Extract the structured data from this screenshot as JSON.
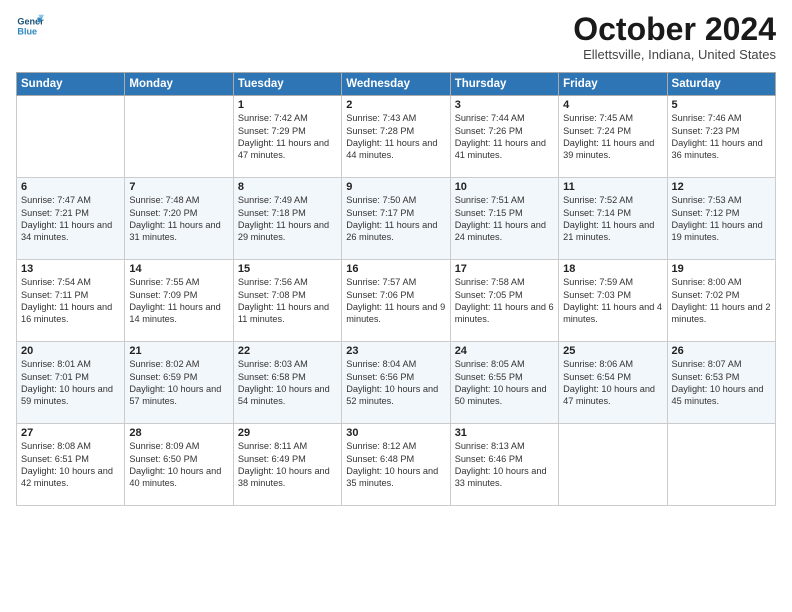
{
  "logo": {
    "line1": "General",
    "line2": "Blue"
  },
  "title": "October 2024",
  "location": "Ellettsville, Indiana, United States",
  "headers": [
    "Sunday",
    "Monday",
    "Tuesday",
    "Wednesday",
    "Thursday",
    "Friday",
    "Saturday"
  ],
  "weeks": [
    [
      {
        "day": "",
        "sunrise": "",
        "sunset": "",
        "daylight": ""
      },
      {
        "day": "",
        "sunrise": "",
        "sunset": "",
        "daylight": ""
      },
      {
        "day": "1",
        "sunrise": "Sunrise: 7:42 AM",
        "sunset": "Sunset: 7:29 PM",
        "daylight": "Daylight: 11 hours and 47 minutes."
      },
      {
        "day": "2",
        "sunrise": "Sunrise: 7:43 AM",
        "sunset": "Sunset: 7:28 PM",
        "daylight": "Daylight: 11 hours and 44 minutes."
      },
      {
        "day": "3",
        "sunrise": "Sunrise: 7:44 AM",
        "sunset": "Sunset: 7:26 PM",
        "daylight": "Daylight: 11 hours and 41 minutes."
      },
      {
        "day": "4",
        "sunrise": "Sunrise: 7:45 AM",
        "sunset": "Sunset: 7:24 PM",
        "daylight": "Daylight: 11 hours and 39 minutes."
      },
      {
        "day": "5",
        "sunrise": "Sunrise: 7:46 AM",
        "sunset": "Sunset: 7:23 PM",
        "daylight": "Daylight: 11 hours and 36 minutes."
      }
    ],
    [
      {
        "day": "6",
        "sunrise": "Sunrise: 7:47 AM",
        "sunset": "Sunset: 7:21 PM",
        "daylight": "Daylight: 11 hours and 34 minutes."
      },
      {
        "day": "7",
        "sunrise": "Sunrise: 7:48 AM",
        "sunset": "Sunset: 7:20 PM",
        "daylight": "Daylight: 11 hours and 31 minutes."
      },
      {
        "day": "8",
        "sunrise": "Sunrise: 7:49 AM",
        "sunset": "Sunset: 7:18 PM",
        "daylight": "Daylight: 11 hours and 29 minutes."
      },
      {
        "day": "9",
        "sunrise": "Sunrise: 7:50 AM",
        "sunset": "Sunset: 7:17 PM",
        "daylight": "Daylight: 11 hours and 26 minutes."
      },
      {
        "day": "10",
        "sunrise": "Sunrise: 7:51 AM",
        "sunset": "Sunset: 7:15 PM",
        "daylight": "Daylight: 11 hours and 24 minutes."
      },
      {
        "day": "11",
        "sunrise": "Sunrise: 7:52 AM",
        "sunset": "Sunset: 7:14 PM",
        "daylight": "Daylight: 11 hours and 21 minutes."
      },
      {
        "day": "12",
        "sunrise": "Sunrise: 7:53 AM",
        "sunset": "Sunset: 7:12 PM",
        "daylight": "Daylight: 11 hours and 19 minutes."
      }
    ],
    [
      {
        "day": "13",
        "sunrise": "Sunrise: 7:54 AM",
        "sunset": "Sunset: 7:11 PM",
        "daylight": "Daylight: 11 hours and 16 minutes."
      },
      {
        "day": "14",
        "sunrise": "Sunrise: 7:55 AM",
        "sunset": "Sunset: 7:09 PM",
        "daylight": "Daylight: 11 hours and 14 minutes."
      },
      {
        "day": "15",
        "sunrise": "Sunrise: 7:56 AM",
        "sunset": "Sunset: 7:08 PM",
        "daylight": "Daylight: 11 hours and 11 minutes."
      },
      {
        "day": "16",
        "sunrise": "Sunrise: 7:57 AM",
        "sunset": "Sunset: 7:06 PM",
        "daylight": "Daylight: 11 hours and 9 minutes."
      },
      {
        "day": "17",
        "sunrise": "Sunrise: 7:58 AM",
        "sunset": "Sunset: 7:05 PM",
        "daylight": "Daylight: 11 hours and 6 minutes."
      },
      {
        "day": "18",
        "sunrise": "Sunrise: 7:59 AM",
        "sunset": "Sunset: 7:03 PM",
        "daylight": "Daylight: 11 hours and 4 minutes."
      },
      {
        "day": "19",
        "sunrise": "Sunrise: 8:00 AM",
        "sunset": "Sunset: 7:02 PM",
        "daylight": "Daylight: 11 hours and 2 minutes."
      }
    ],
    [
      {
        "day": "20",
        "sunrise": "Sunrise: 8:01 AM",
        "sunset": "Sunset: 7:01 PM",
        "daylight": "Daylight: 10 hours and 59 minutes."
      },
      {
        "day": "21",
        "sunrise": "Sunrise: 8:02 AM",
        "sunset": "Sunset: 6:59 PM",
        "daylight": "Daylight: 10 hours and 57 minutes."
      },
      {
        "day": "22",
        "sunrise": "Sunrise: 8:03 AM",
        "sunset": "Sunset: 6:58 PM",
        "daylight": "Daylight: 10 hours and 54 minutes."
      },
      {
        "day": "23",
        "sunrise": "Sunrise: 8:04 AM",
        "sunset": "Sunset: 6:56 PM",
        "daylight": "Daylight: 10 hours and 52 minutes."
      },
      {
        "day": "24",
        "sunrise": "Sunrise: 8:05 AM",
        "sunset": "Sunset: 6:55 PM",
        "daylight": "Daylight: 10 hours and 50 minutes."
      },
      {
        "day": "25",
        "sunrise": "Sunrise: 8:06 AM",
        "sunset": "Sunset: 6:54 PM",
        "daylight": "Daylight: 10 hours and 47 minutes."
      },
      {
        "day": "26",
        "sunrise": "Sunrise: 8:07 AM",
        "sunset": "Sunset: 6:53 PM",
        "daylight": "Daylight: 10 hours and 45 minutes."
      }
    ],
    [
      {
        "day": "27",
        "sunrise": "Sunrise: 8:08 AM",
        "sunset": "Sunset: 6:51 PM",
        "daylight": "Daylight: 10 hours and 42 minutes."
      },
      {
        "day": "28",
        "sunrise": "Sunrise: 8:09 AM",
        "sunset": "Sunset: 6:50 PM",
        "daylight": "Daylight: 10 hours and 40 minutes."
      },
      {
        "day": "29",
        "sunrise": "Sunrise: 8:11 AM",
        "sunset": "Sunset: 6:49 PM",
        "daylight": "Daylight: 10 hours and 38 minutes."
      },
      {
        "day": "30",
        "sunrise": "Sunrise: 8:12 AM",
        "sunset": "Sunset: 6:48 PM",
        "daylight": "Daylight: 10 hours and 35 minutes."
      },
      {
        "day": "31",
        "sunrise": "Sunrise: 8:13 AM",
        "sunset": "Sunset: 6:46 PM",
        "daylight": "Daylight: 10 hours and 33 minutes."
      },
      {
        "day": "",
        "sunrise": "",
        "sunset": "",
        "daylight": ""
      },
      {
        "day": "",
        "sunrise": "",
        "sunset": "",
        "daylight": ""
      }
    ]
  ]
}
